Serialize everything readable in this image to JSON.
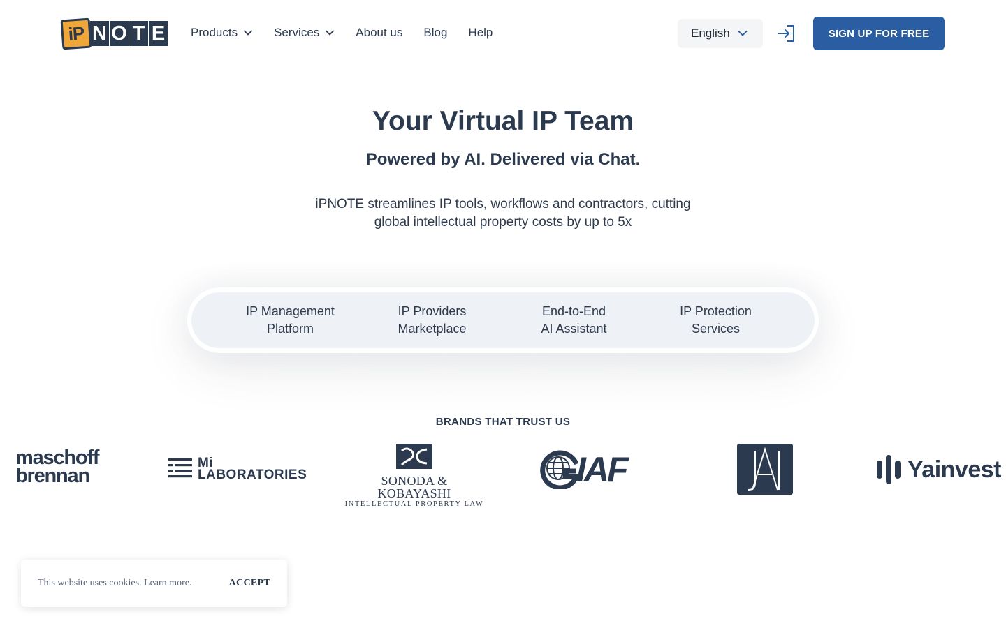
{
  "header": {
    "logo": {
      "ip": "iP",
      "note": [
        "N",
        "O",
        "T",
        "E"
      ]
    },
    "nav": [
      {
        "label": "Products",
        "has_dropdown": true
      },
      {
        "label": "Services",
        "has_dropdown": true
      },
      {
        "label": "About us",
        "has_dropdown": false
      },
      {
        "label": "Blog",
        "has_dropdown": false
      },
      {
        "label": "Help",
        "has_dropdown": false
      }
    ],
    "language": "English",
    "login_icon": "login-icon",
    "signup_label": "SIGN UP FOR FREE"
  },
  "hero": {
    "title": "Your Virtual IP Team",
    "subtitle": "Powered by AI. Delivered via Chat.",
    "description_line1": "iPNOTE streamlines IP tools, workflows and contractors, cutting",
    "description_line2": "global intellectual property costs by up to 5x"
  },
  "tabs": [
    {
      "line1": "IP Management",
      "line2": "Platform"
    },
    {
      "line1": "IP Providers",
      "line2": "Marketplace"
    },
    {
      "line1": "End-to-End",
      "line2": "AI Assistant"
    },
    {
      "line1": "IP Protection",
      "line2": "Services"
    }
  ],
  "brands": {
    "title": "BRANDS THAT TRUST US",
    "maschoff": {
      "line1": "maschoff",
      "line2": "brennan"
    },
    "mi": {
      "line1": "Mi",
      "line2": "LABORATORIES"
    },
    "sonoda": {
      "name": "SONODA & KOBAYASHI",
      "sub": "INTELLECTUAL PROPERTY LAW"
    },
    "giaf": "IAF",
    "yainvest": "Yainvest"
  },
  "cookie": {
    "message": "This website uses cookies. Learn more.",
    "accept": "ACCEPT"
  },
  "colors": {
    "brand_dark": "#2c3a4f",
    "brand_orange": "#f0a73a",
    "cta_blue": "#2b5da2",
    "pill_bg": "#eef1f5"
  }
}
